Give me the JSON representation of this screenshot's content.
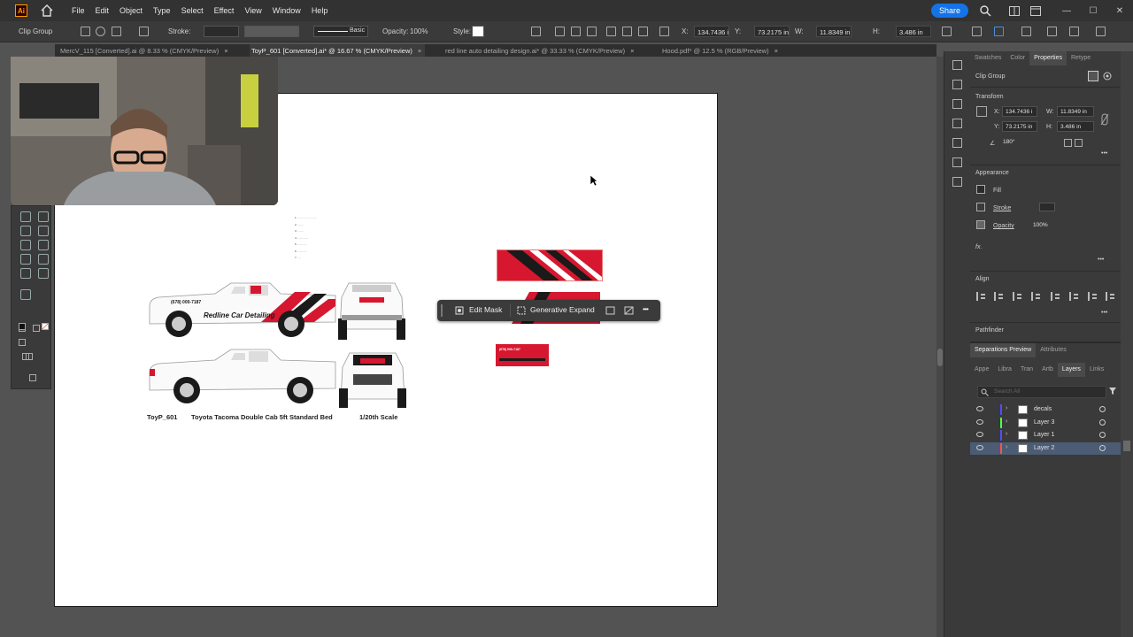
{
  "app": {
    "logo_text": "Ai"
  },
  "menubar": {
    "items": [
      "File",
      "Edit",
      "Object",
      "Type",
      "Select",
      "Effect",
      "View",
      "Window",
      "Help"
    ],
    "share_label": "Share"
  },
  "controlbar": {
    "object_type": "Clip Group",
    "stroke_label": "Stroke:",
    "brush_label": "Basic",
    "opacity_label": "Opacity:",
    "opacity_value": "100%",
    "style_label": "Style:",
    "x_label": "X:",
    "x_value": "134.7436 ir",
    "y_label": "Y:",
    "y_value": "73.2175 in",
    "w_label": "W:",
    "w_value": "11.8349 in",
    "h_label": "H:",
    "h_value": "3.486 in"
  },
  "tabs": [
    {
      "label": "MercV_115 [Converted].ai @ 8.33 % (CMYK/Preview)"
    },
    {
      "label": "ToyP_601 [Converted].ai* @ 16.67 % (CMYK/Preview)"
    },
    {
      "label": "red line auto detailing design.ai* @ 33.33 % (CMYK/Preview)"
    },
    {
      "label": "Hood.pdf* @ 12.5 % (RGB/Preview)"
    }
  ],
  "tab_close": "×",
  "artboard": {
    "notes_lines": [
      "1. ..........................",
      "2. ........",
      "3. ........",
      "4. ..............",
      "5. ............",
      "6. ............",
      "7. ...."
    ],
    "truck_text": "Redline Car Detailing",
    "truck_phone": "(678) 000-7187",
    "label_code": "ToyP_601",
    "label_model": "Toyota Tacoma Double Cab 5ft Standard Bed",
    "label_scale": "1/20th Scale",
    "card_text": "(678) 000-7187"
  },
  "context_bar": {
    "edit_mask": "Edit Mask",
    "generative_expand": "Generative Expand",
    "more": "•••"
  },
  "right_panel": {
    "tabs": [
      "Swatches",
      "Color",
      "Properties",
      "Retype"
    ],
    "active_tab": "Properties",
    "object_type": "Clip Group",
    "transform_title": "Transform",
    "x_label": "X:",
    "x_value": "134.7436 i",
    "y_label": "Y:",
    "y_value": "73.2175 in",
    "w_label": "W:",
    "w_value": "11.8349 in",
    "h_label": "H:",
    "h_value": "3.486 in",
    "rotate_value": "180°",
    "appearance_title": "Appearance",
    "fill_label": "Fill",
    "stroke_label": "Stroke",
    "opacity_label": "Opacity",
    "opacity_value": "100%",
    "fx_label": "fx.",
    "align_title": "Align",
    "pathfinder_title": "Pathfinder",
    "more": "•••"
  },
  "bottom_panel": {
    "tabs_top": [
      "Separations Preview",
      "Attributes"
    ],
    "tabs": [
      "Appe",
      "Libra",
      "Tran",
      "Artb",
      "Layers",
      "Links"
    ],
    "active_tab": "Layers",
    "search_placeholder": "Search All",
    "layers": [
      {
        "name": "decals",
        "color": "#4f4fff"
      },
      {
        "name": "Layer 3",
        "color": "#4fff4f"
      },
      {
        "name": "Layer 1",
        "color": "#4f4fff"
      },
      {
        "name": "Layer 2",
        "color": "#ff4f4f"
      }
    ]
  },
  "colors": {
    "accent": "#1473e6",
    "brand_red": "#d6172f",
    "selection": "#4b5c74"
  }
}
